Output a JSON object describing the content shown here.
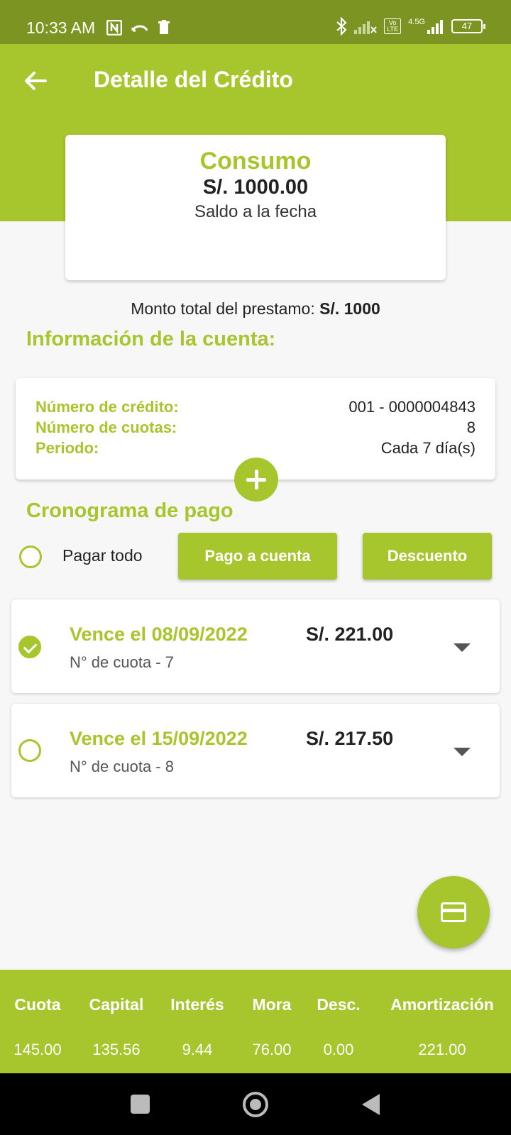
{
  "status_bar": {
    "time": "10:33 AM",
    "network_label": "4.5G",
    "volte_label": "Vo LTE",
    "battery": "47"
  },
  "header": {
    "title": "Detalle del Crédito",
    "back_icon": "arrow-left-icon"
  },
  "summary": {
    "type": "Consumo",
    "amount": "S/. 1000.00",
    "caption": "Saldo a la fecha"
  },
  "loan_total": {
    "label": "Monto total del prestamo:",
    "value": "S/. 1000"
  },
  "account_info": {
    "title": "Información de la cuenta:",
    "rows": [
      {
        "label": "Número de crédito:",
        "value": "001 - 0000004843"
      },
      {
        "label": "Número de cuotas:",
        "value": "8"
      },
      {
        "label": "Periodo:",
        "value": "Cada 7 día(s)"
      }
    ]
  },
  "schedule": {
    "title": "Cronograma de pago",
    "pay_all_label": "Pagar todo",
    "pay_all_checked": false,
    "buttons": {
      "pay_on_account": "Pago a cuenta",
      "discount": "Descuento"
    },
    "installments": [
      {
        "due": "Vence el 08/09/2022",
        "number": "N° de cuota - 7",
        "amount": "S/. 221.00",
        "checked": true
      },
      {
        "due": "Vence el 15/09/2022",
        "number": "N° de cuota - 8",
        "amount": "S/. 217.50",
        "checked": false
      }
    ]
  },
  "totals_table": {
    "headers": [
      "Cuota",
      "Capital",
      "Interés",
      "Mora",
      "Desc.",
      "Amortización"
    ],
    "values": [
      "145.00",
      "135.56",
      "9.44",
      "76.00",
      "0.00",
      "221.00"
    ]
  },
  "colors": {
    "accent": "#a7c52c",
    "status_bar": "#7b9422",
    "nav_bar": "#000000"
  },
  "icons": {
    "add_fab": "plus-icon",
    "card_fab": "credit-card-icon",
    "expand": "chevron-down-icon"
  }
}
